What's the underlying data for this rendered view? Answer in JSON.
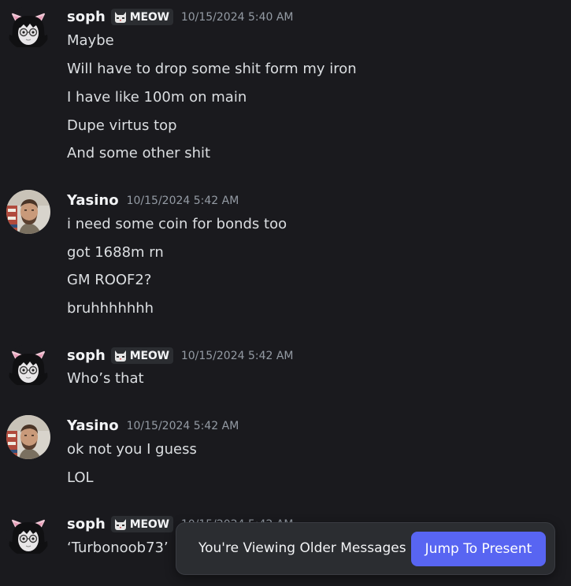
{
  "banner": {
    "text": "You're Viewing Older Messages",
    "button": "Jump To Present",
    "button_color": "#5865f2"
  },
  "messages": [
    {
      "author": "soph",
      "tag": "MEOW",
      "timestamp": "10/15/2024 5:40 AM",
      "lines": [
        "Maybe",
        "Will have to drop some shit form my iron",
        "I have like 100m on main",
        "Dupe virtus top",
        "And some other shit"
      ]
    },
    {
      "author": "Yasino",
      "timestamp": "10/15/2024 5:42 AM",
      "lines": [
        "i need some coin for bonds too",
        "got 1688m rn",
        "GM ROOF2?",
        "bruhhhhhhh"
      ]
    },
    {
      "author": "soph",
      "tag": "MEOW",
      "timestamp": "10/15/2024 5:42 AM",
      "lines": [
        "Who’s that"
      ]
    },
    {
      "author": "Yasino",
      "timestamp": "10/15/2024 5:42 AM",
      "lines": [
        "ok not you I guess",
        "LOL"
      ]
    },
    {
      "author": "soph",
      "tag": "MEOW",
      "timestamp": "10/15/2024 5:42 AM",
      "lines": [
        "‘Turbonoob73’"
      ]
    }
  ]
}
